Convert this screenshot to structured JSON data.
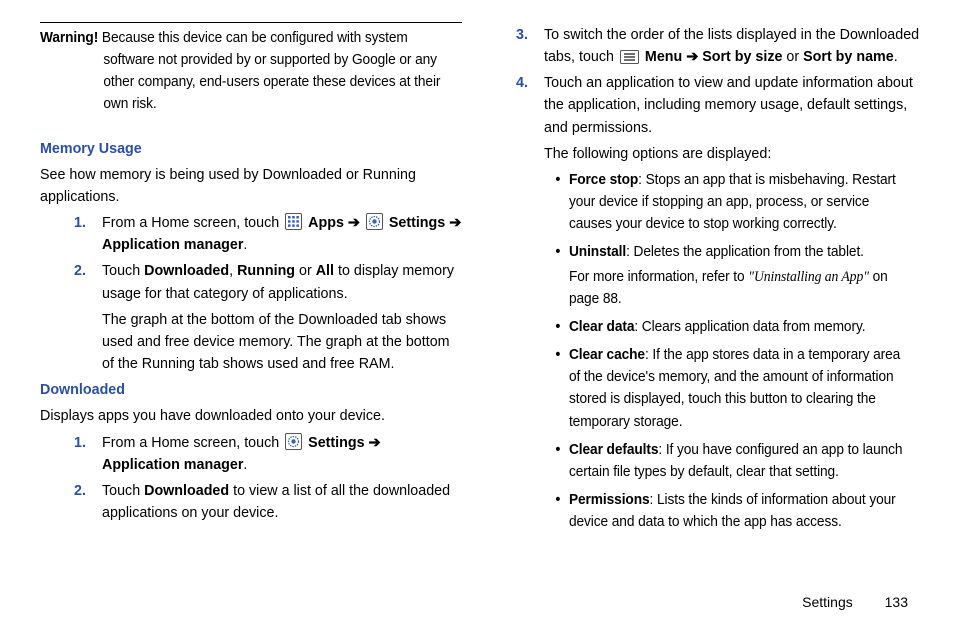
{
  "left": {
    "warning_label": "Warning!",
    "warning_text": " Because this device can be configured with system software not provided by or supported by Google or any other company, end-users operate these devices at their own risk.",
    "memory_heading": "Memory Usage",
    "memory_intro": "See how memory is being used by Downloaded or Running applications.",
    "step1_a": "From a Home screen, touch ",
    "step1_apps": " Apps ",
    "arrow": "➔",
    "step1_settings": " Settings ",
    "step1_b": " Application manager",
    "period": ".",
    "step2_a": "Touch ",
    "step2_d": "Downloaded",
    "step2_b": ", ",
    "step2_r": "Running",
    "step2_c": " or ",
    "step2_all": "All",
    "step2_e": " to display memory usage for that category of applications.",
    "step2_cont": "The graph at the bottom of the Downloaded tab shows used and free device memory. The graph at the bottom of the Running tab shows used and free RAM.",
    "dl_heading": "Downloaded",
    "dl_intro": "Displays apps you have downloaded onto your device.",
    "dl1_a": "From a Home screen, touch ",
    "dl1_settings": " Settings ",
    "dl1_b": " Application manager",
    "dl2_a": "Touch ",
    "dl2_d": "Downloaded",
    "dl2_b": " to view a list of all the downloaded applications on your device."
  },
  "right": {
    "s3_a": "To switch the order of the lists displayed in the Downloaded tabs, touch ",
    "s3_menu": " Menu ",
    "s3_sort1": " Sort by size",
    "s3_or": " or ",
    "s3_sort2": "Sort by name",
    "s4_a": "Touch an application to view and update information about the application, including memory usage, default settings, and permissions.",
    "s4_b": "The following options are displayed:",
    "b_force_l": "Force stop",
    "b_force_t": ": Stops an app that is misbehaving. Restart your device if stopping an app, process, or service causes your device to stop working correctly.",
    "b_un_l": "Uninstall",
    "b_un_t": ": Deletes the application from the tablet.",
    "b_un_ref_a": "For more information, refer to ",
    "b_un_ref_i": "\"Uninstalling an App\"",
    "b_un_ref_b": " on page 88.",
    "b_cd_l": "Clear data",
    "b_cd_t": ": Clears application data from memory.",
    "b_cc_l": "Clear cache",
    "b_cc_t": ": If the app stores data in a temporary area of the device's memory, and the amount of information stored is displayed, touch this button to clearing the temporary storage.",
    "b_cdef_l": "Clear defaults",
    "b_cdef_t": ": If you have configured an app to launch certain file types by default, clear that setting.",
    "b_perm_l": "Permissions",
    "b_perm_t": ": Lists the kinds of information about your device and data to which the app has access."
  },
  "footer": {
    "section": "Settings",
    "page": "133"
  },
  "markers": {
    "m1": "1.",
    "m2": "2.",
    "m3": "3.",
    "m4": "4."
  }
}
